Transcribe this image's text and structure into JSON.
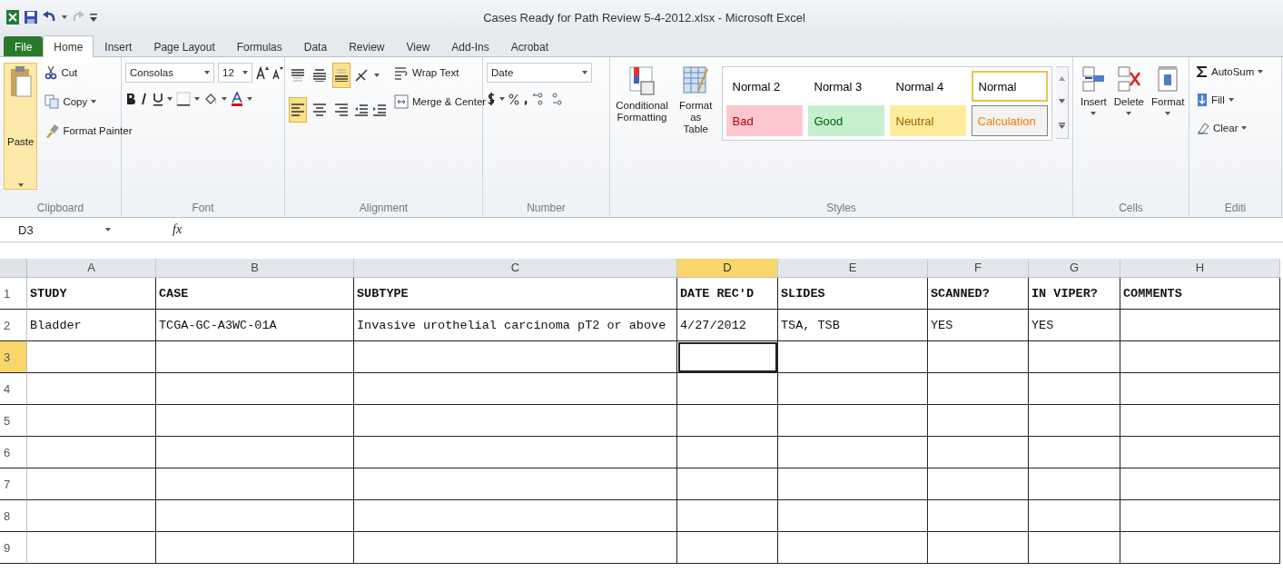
{
  "window": {
    "title": "Cases Ready for Path Review 5-4-2012.xlsx - Microsoft Excel"
  },
  "tabs": [
    {
      "label": "File",
      "kind": "file",
      "selected": false
    },
    {
      "label": "Home",
      "kind": "tab",
      "selected": true
    },
    {
      "label": "Insert",
      "kind": "tab",
      "selected": false
    },
    {
      "label": "Page Layout",
      "kind": "tab",
      "selected": false
    },
    {
      "label": "Formulas",
      "kind": "tab",
      "selected": false
    },
    {
      "label": "Data",
      "kind": "tab",
      "selected": false
    },
    {
      "label": "Review",
      "kind": "tab",
      "selected": false
    },
    {
      "label": "View",
      "kind": "tab",
      "selected": false
    },
    {
      "label": "Add-Ins",
      "kind": "tab",
      "selected": false
    },
    {
      "label": "Acrobat",
      "kind": "tab",
      "selected": false
    }
  ],
  "ribbon": {
    "clipboard": {
      "paste": "Paste",
      "cut": "Cut",
      "copy": "Copy",
      "format_painter": "Format Painter",
      "label": "Clipboard"
    },
    "font": {
      "font_name": "Consolas",
      "font_size": "12",
      "label": "Font"
    },
    "alignment": {
      "buttons": [
        {
          "kind": "top",
          "on": false
        },
        {
          "kind": "middle",
          "on": false
        },
        {
          "kind": "bottom",
          "on": true
        },
        {
          "kind": "left",
          "on": true
        },
        {
          "kind": "center",
          "on": false
        },
        {
          "kind": "right",
          "on": false
        }
      ],
      "wrap_text": "Wrap Text",
      "merge_center": "Merge & Center",
      "label": "Alignment"
    },
    "number": {
      "format": "Date",
      "label": "Number"
    },
    "styles": {
      "conditional_formatting": "Conditional Formatting",
      "format_as_table": "Format as Table",
      "gallery": [
        {
          "label": "Normal 2",
          "kind": "normal",
          "color": "#ffffff",
          "selected": false
        },
        {
          "label": "Normal 3",
          "kind": "normal",
          "color": "#ffffff",
          "selected": false
        },
        {
          "label": "Normal 4",
          "kind": "normal",
          "color": "#ffffff",
          "selected": false
        },
        {
          "label": "Normal",
          "kind": "normal",
          "color": "#ffffff",
          "selected": true
        },
        {
          "label": "Bad",
          "kind": "bad",
          "color": "#ffc7ce",
          "selected": false
        },
        {
          "label": "Good",
          "kind": "good",
          "color": "#c6efce",
          "selected": false
        },
        {
          "label": "Neutral",
          "kind": "neutral",
          "color": "#ffeb9c",
          "selected": false
        },
        {
          "label": "Calculation",
          "kind": "calculation",
          "color": "#f2f2f2",
          "selected": false
        }
      ],
      "label": "Styles"
    },
    "cells": {
      "buttons": [
        "Insert",
        "Delete",
        "Format"
      ],
      "label": "Cells"
    },
    "editing": {
      "autosum": "AutoSum",
      "fill": "Fill",
      "clear": "Clear",
      "label": "Editi"
    }
  },
  "formula_bar": {
    "name_box": "D3",
    "fx": "fx"
  },
  "sheet": {
    "columns": [
      {
        "label": "A",
        "selected": false
      },
      {
        "label": "B",
        "selected": false
      },
      {
        "label": "C",
        "selected": false
      },
      {
        "label": "D",
        "selected": true
      },
      {
        "label": "E",
        "selected": false
      },
      {
        "label": "F",
        "selected": false
      },
      {
        "label": "G",
        "selected": false
      },
      {
        "label": "H",
        "selected": false
      }
    ],
    "rows": [
      {
        "number": "1",
        "selected": false,
        "kind": "header",
        "cells": [
          "STUDY",
          "CASE",
          "SUBTYPE",
          "DATE REC'D",
          "SLIDES",
          "SCANNED?",
          "IN VIPER?",
          "COMMENTS"
        ]
      },
      {
        "number": "2",
        "selected": false,
        "kind": "data",
        "cells": [
          "Bladder",
          "TCGA-GC-A3WC-01A",
          "Invasive urothelial carcinoma pT2 or above",
          "4/27/2012",
          "TSA, TSB",
          "YES",
          "YES"
        ]
      },
      {
        "number": "3",
        "selected": true,
        "kind": "data"
      },
      {
        "number": "4",
        "selected": false,
        "kind": "data"
      },
      {
        "number": "5",
        "selected": false,
        "kind": "data"
      },
      {
        "number": "6",
        "selected": false,
        "kind": "data"
      },
      {
        "number": "7",
        "selected": false,
        "kind": "data"
      },
      {
        "number": "8",
        "selected": false,
        "kind": "data"
      },
      {
        "number": "9",
        "selected": false,
        "kind": "data"
      }
    ]
  }
}
